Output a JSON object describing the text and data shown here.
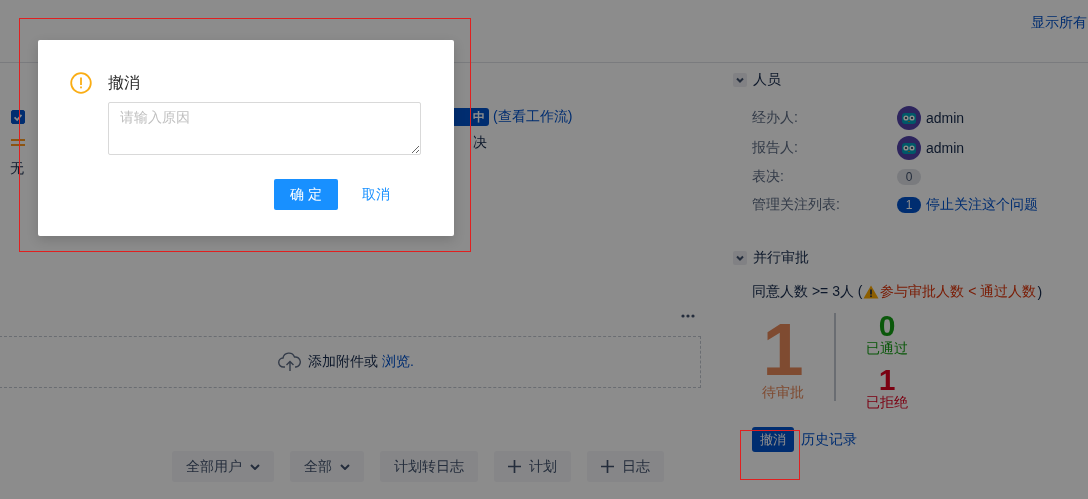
{
  "header": {
    "show_all_link": "显示所有"
  },
  "summary": {
    "checked": true,
    "status_badge": "中",
    "workflow_link": "(查看工作流)"
  },
  "priority_row": {
    "resolution": "决"
  },
  "value_none": "无",
  "attachments": {
    "text": "添加附件或",
    "browse_link": "浏览."
  },
  "toolbar": [
    {
      "label": "全部用户",
      "kind": "dropdown"
    },
    {
      "label": "全部",
      "kind": "dropdown"
    },
    {
      "label": "计划转日志",
      "kind": "plain"
    },
    {
      "label": "计划",
      "kind": "add"
    },
    {
      "label": "日志",
      "kind": "add"
    }
  ],
  "people": {
    "title": "人员",
    "expanded": true,
    "rows": [
      {
        "label": "经办人:",
        "kind": "user",
        "value": "admin"
      },
      {
        "label": "报告人:",
        "kind": "user",
        "value": "admin"
      },
      {
        "label": "表决:",
        "kind": "count",
        "count": "0"
      },
      {
        "label": "管理关注列表:",
        "kind": "watch",
        "count": "1",
        "link": "停止关注这个问题"
      }
    ]
  },
  "approval": {
    "title": "并行审批",
    "expanded": true,
    "rule_prefix": "同意人数 >= 3人 (",
    "warning": "参与审批人数 < 通过人数",
    "rule_suffix": ")",
    "pending": {
      "value": "1",
      "label": "待审批"
    },
    "passed": {
      "value": "0",
      "label": "已通过"
    },
    "rejected": {
      "value": "1",
      "label": "已拒绝"
    },
    "revoke_button": "撤消",
    "history_link": "历史记录"
  },
  "dialog": {
    "title": "撤消",
    "reason_placeholder": "请输入原因",
    "confirm_button": "确 定",
    "cancel_button": "取消"
  }
}
